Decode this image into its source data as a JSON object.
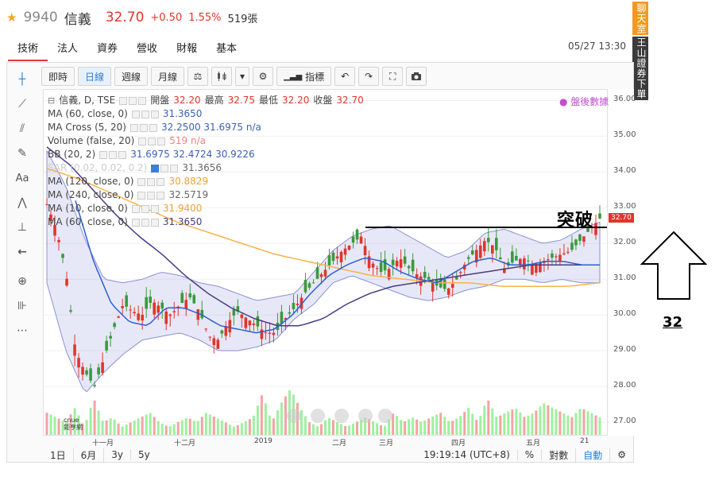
{
  "header": {
    "code": "9940",
    "name": "信義",
    "price": "32.70",
    "change": "+0.50",
    "change_pct": "1.55%",
    "volume": "519張"
  },
  "tabs": [
    "技術",
    "法人",
    "資券",
    "營收",
    "財報",
    "基本"
  ],
  "active_tab": "技術",
  "datetime": "05/27 13:30",
  "side": {
    "chat": "聊天室",
    "broker": "王山證券下單"
  },
  "toolbar": {
    "intraday": "即時",
    "daily": "日線",
    "weekly": "週線",
    "monthly": "月線",
    "indicators": "指標"
  },
  "legend": {
    "main": {
      "name": "信義, D, TSE",
      "open_label": "開盤",
      "open": "32.20",
      "high_label": "最高",
      "high": "32.75",
      "low_label": "最低",
      "low": "32.20",
      "close_label": "收盤",
      "close": "32.70"
    },
    "rows": [
      {
        "name": "MA (60, close, 0)",
        "values": "31.3650",
        "color": "blue"
      },
      {
        "name": "MA Cross (5, 20)",
        "values": "32.2500  31.6975  n/a",
        "color": "blue"
      },
      {
        "name": "Volume (false, 20)",
        "values": "519  n/a",
        "color": "pink"
      },
      {
        "name": "BB (20, 2)",
        "values": "31.6975  32.4724  30.9226",
        "color": "blue"
      },
      {
        "name": "SAR (0.02, 0.02, 0.2)",
        "values": "31.3656",
        "color": "gray"
      },
      {
        "name": "MA (120, close, 0)",
        "values": "30.8829",
        "color": "orange"
      },
      {
        "name": "MA (240, close, 0)",
        "values": "32.5719",
        "color": "gray"
      },
      {
        "name": "MA (10, close, 0)",
        "values": "31.9400",
        "color": "orange"
      },
      {
        "name": "MA (60, close, 0)",
        "values": "31.3650",
        "color": "purple"
      }
    ]
  },
  "after_hours": "● 盤後數據",
  "y_axis": {
    "ticks": [
      "36.00",
      "35.00",
      "34.00",
      "33.00",
      "32.00",
      "31.00",
      "30.00",
      "29.00",
      "28.00",
      "27.00"
    ],
    "last": "32.70"
  },
  "x_axis": {
    "ticks": [
      "十一月",
      "十二月",
      "2019",
      "二月",
      "三月",
      "四月",
      "五月",
      "21"
    ]
  },
  "bottom": {
    "ranges": [
      "1日",
      "6月",
      "3y",
      "5y"
    ],
    "clock": "19:19:14 (UTC+8)",
    "pct": "%",
    "log": "對數",
    "auto": "自動"
  },
  "annotations": {
    "breakout": "突破",
    "level": "32"
  },
  "watermark": {
    "line1": "cnue",
    "line2": "鉅亨網"
  },
  "chart_data": {
    "type": "candlestick",
    "ylim": [
      26.6,
      36.3
    ],
    "x": [
      "十一月",
      "十二月",
      "2019",
      "二月",
      "三月",
      "四月",
      "五月",
      "21"
    ],
    "resistance": 32.45,
    "close_path": [
      33.1,
      32.4,
      31.2,
      29.0,
      28.4,
      28.0,
      28.8,
      29.6,
      30.3,
      30.1,
      30.0,
      30.4,
      30.2,
      30.0,
      30.3,
      30.5,
      30.1,
      29.4,
      29.3,
      29.8,
      30.1,
      29.9,
      29.7,
      29.5,
      29.5,
      29.9,
      30.2,
      30.6,
      30.9,
      31.2,
      31.5,
      31.8,
      32.0,
      32.2,
      31.5,
      31.2,
      31.3,
      31.6,
      31.3,
      31.1,
      31.0,
      30.8,
      30.7,
      31.0,
      31.5,
      31.8,
      32.1,
      31.9,
      31.3,
      31.5,
      31.6,
      31.4,
      31.5,
      31.6,
      31.7,
      31.8,
      32.1,
      32.4,
      32.7
    ],
    "bb_upper": [
      34.6,
      33.6,
      32.1,
      31.0,
      30.9,
      31.0,
      31.2,
      31.1,
      30.9,
      30.8,
      30.6,
      30.4,
      30.5,
      30.6,
      31.2,
      31.8,
      32.2,
      32.4,
      32.5,
      32.2,
      31.9,
      31.6,
      31.8,
      32.3,
      32.4,
      32.2,
      32.0,
      32.1,
      32.4,
      32.6
    ],
    "bb_lower": [
      30.9,
      29.0,
      27.8,
      28.4,
      28.9,
      29.3,
      29.4,
      29.5,
      29.3,
      29.0,
      29.0,
      29.1,
      29.3,
      29.9,
      30.3,
      30.9,
      31.1,
      30.9,
      30.7,
      30.5,
      30.4,
      30.5,
      30.7,
      30.8,
      31.0,
      31.0,
      30.9,
      31.0,
      30.9,
      30.9
    ],
    "ma20": [
      33.2,
      31.5,
      30.3,
      29.8,
      29.7,
      30.2,
      30.2,
      30.0,
      29.7,
      29.6,
      29.5,
      29.6,
      30.0,
      30.6,
      31.1,
      31.4,
      31.6,
      31.5,
      31.2,
      31.0,
      30.9,
      31.2,
      31.5,
      31.6,
      31.4,
      31.4,
      31.5,
      31.5,
      31.4,
      31.4
    ],
    "ma60": [
      34.7,
      34.2,
      33.5,
      32.8,
      32.2,
      31.7,
      31.1,
      30.6,
      30.2,
      29.9,
      29.7,
      29.7,
      29.9,
      30.3,
      30.6,
      30.8,
      30.9,
      31.0,
      31.1,
      31.2,
      31.3,
      31.4,
      31.4,
      31.4,
      31.4
    ],
    "ma120": [
      34.1,
      33.8,
      33.4,
      33.0,
      32.6,
      32.3,
      32.0,
      31.7,
      31.5,
      31.3,
      31.1,
      31.0,
      30.9,
      30.9,
      30.8,
      30.8,
      30.8,
      30.9
    ],
    "volume": [
      5,
      4,
      3,
      6,
      2,
      8,
      3,
      4,
      2,
      3,
      4,
      5,
      3,
      2,
      3,
      4,
      3,
      5,
      4,
      3,
      2,
      3,
      4,
      9,
      3,
      7,
      10,
      6,
      3,
      2,
      4,
      3,
      2,
      3,
      4,
      3,
      2,
      5,
      3,
      4,
      3,
      4,
      5,
      3,
      4,
      6,
      3,
      8,
      4,
      5,
      6,
      4,
      5,
      7,
      6,
      5,
      4,
      6,
      5,
      4
    ]
  }
}
